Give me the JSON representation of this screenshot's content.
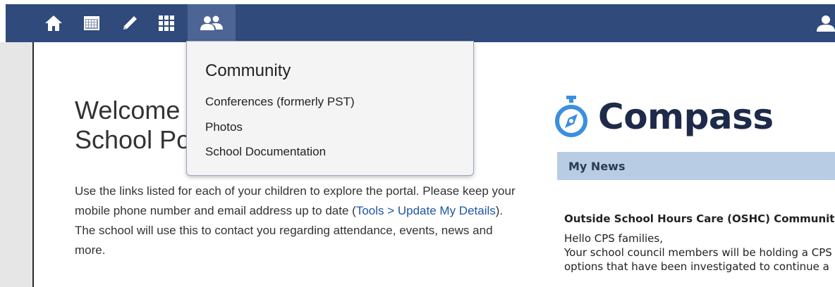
{
  "nav": {
    "icons": [
      "home-icon",
      "calendar-icon",
      "pencil-icon",
      "grid-icon",
      "community-icon",
      "user-icon"
    ],
    "colors": {
      "bar": "#2f4a7b",
      "active": "#4d6594"
    }
  },
  "welcome": {
    "title_line1": "Welcome to the",
    "title_line2": "School Portal",
    "body_before_link": "Use the links listed for each of your children to explore the portal. Please keep your mobile phone number and email address up to date (",
    "link_text": "Tools > Update My Details",
    "body_after_link": "). The school will use this to contact you regarding attendance, events, news and more."
  },
  "dropdown": {
    "title": "Community",
    "items": [
      {
        "label": "Conferences (formerly PST)"
      },
      {
        "label": "Photos"
      },
      {
        "label": "School Documentation"
      }
    ]
  },
  "logo": {
    "text": "Compass",
    "color": "#3b8fe0"
  },
  "news": {
    "header": "My News",
    "item_title": "Outside School Hours Care (OSHC) Community",
    "line1": "Hello CPS families,",
    "line2": "Your school council members will be holding a CPS",
    "line3": "options that have been investigated to continue a"
  }
}
